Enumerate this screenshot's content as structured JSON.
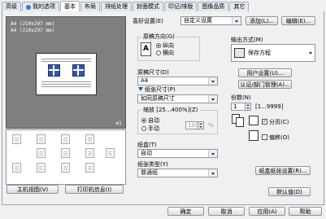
{
  "tabs": [
    "高级",
    "我的选项",
    "基本",
    "布局",
    "排纸处理",
    "封面模式",
    "印记/排版",
    "图像品质",
    "其它"
  ],
  "active_tab": "基本",
  "preview": {
    "line1": "A4 (210x297 mm)",
    "line2": "A4 (210x297 mm)",
    "page_no": "e1"
  },
  "left_buttons": {
    "printer_view": "主机视图(V)",
    "printer_info": "打印机信息(I)"
  },
  "favorite": {
    "label": "喜好设置(E)",
    "value": "自定义设置",
    "add": "添加(L)...",
    "edit": "编辑(E)..."
  },
  "orientation": {
    "title": "原稿方向(G)",
    "portrait": "纵向",
    "landscape": "横向",
    "selected": "portrait"
  },
  "original_size": {
    "label": "原稿尺寸(D)",
    "value": "A4"
  },
  "paper_size": {
    "label": "纸张尺寸(P)",
    "value": "如同原稿尺寸"
  },
  "zoom": {
    "label": "缩放 [25...400%](Z)",
    "auto": "自动",
    "manual": "手动",
    "value": "100",
    "unit": "%",
    "selected": "auto"
  },
  "tray": {
    "label": "纸盒(T)",
    "value": "自动"
  },
  "paper_type": {
    "label": "纸张类型(Y)",
    "value": "普通纸"
  },
  "output": {
    "label": "输出方式(M)",
    "value": "保存方程"
  },
  "user_settings": "用户设置(U)...",
  "auth": "认证/部门管理(A)...",
  "copies": {
    "label": "份数(N)",
    "value": "1",
    "range": "[1...9999]"
  },
  "collate": {
    "label": "分页(C)",
    "checked": true
  },
  "offset": {
    "label": "偏移(O)",
    "checked": false
  },
  "tray_settings": "纸盒纸张设置(R)...",
  "defaults": "默认值(D)",
  "footer": {
    "ok": "确定",
    "cancel": "取消",
    "apply": "应用(A)",
    "help": "帮助"
  }
}
